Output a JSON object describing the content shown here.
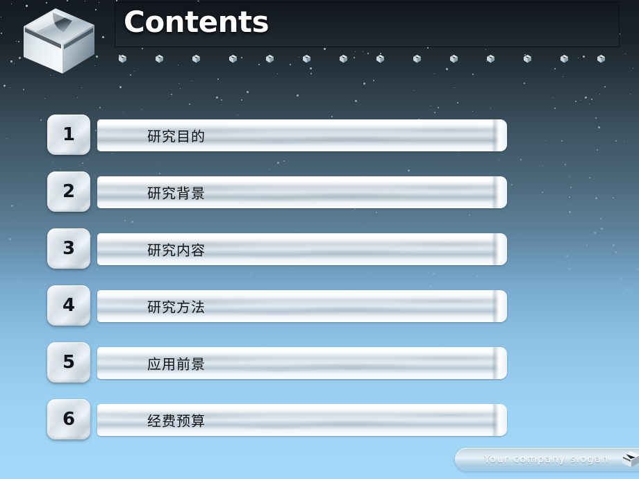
{
  "slide": {
    "title": "Contents",
    "logo_icon": "chrome-cube-icon",
    "decor_icon": "mini-cube-icon",
    "decor_cube_count": 14,
    "background_colors": {
      "top": "#141a20",
      "mid": "#4b687a",
      "bottom": "#a3d8f8"
    },
    "title_panel_bg": "#171e25",
    "title_color": "#ffffff"
  },
  "contents": {
    "items": [
      {
        "number": "1",
        "label": "研究目的"
      },
      {
        "number": "2",
        "label": "研究背景"
      },
      {
        "number": "3",
        "label": "研究内容"
      },
      {
        "number": "4",
        "label": "研究方法"
      },
      {
        "number": "5",
        "label": "应用前景"
      },
      {
        "number": "6",
        "label": "经费预算"
      }
    ]
  },
  "footer": {
    "slogan": "Your company slogan",
    "icon": "cube-logo-icon"
  }
}
